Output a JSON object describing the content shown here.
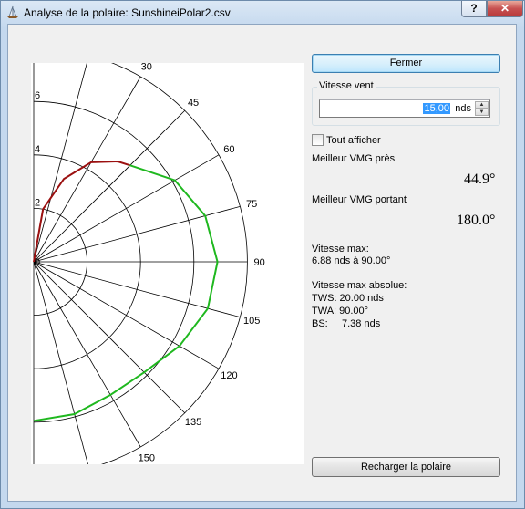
{
  "window": {
    "title": "Analyse de la polaire: SunshineiPolar2.csv",
    "help_label": "?",
    "close_label": "✕"
  },
  "plot": {
    "radial_labels": [
      "2",
      "4",
      "6"
    ],
    "angle_labels": [
      "30",
      "45",
      "60",
      "75",
      "90",
      "105",
      "120",
      "135",
      "150"
    ],
    "origin_label": "0",
    "series_colors": {
      "upwind": "#9b1010",
      "downwind": "#1fb81f"
    }
  },
  "chart_data": {
    "type": "polar",
    "radial_ticks": [
      2,
      4,
      6
    ],
    "angle_ticks": [
      30,
      45,
      60,
      75,
      90,
      105,
      120,
      135,
      150
    ],
    "series": [
      {
        "name": "",
        "color": "#9b1010",
        "points": [
          [
            0,
            0
          ],
          [
            10,
            2.0
          ],
          [
            20,
            3.3
          ],
          [
            30,
            4.3
          ],
          [
            40,
            4.9
          ],
          [
            44.9,
            5.1
          ]
        ]
      },
      {
        "name": "",
        "color": "#1fb81f",
        "points": [
          [
            44.9,
            5.1
          ],
          [
            60,
            6.1
          ],
          [
            75,
            6.65
          ],
          [
            90,
            6.88
          ],
          [
            105,
            6.75
          ],
          [
            120,
            6.3
          ],
          [
            135,
            5.85
          ],
          [
            150,
            5.75
          ],
          [
            165,
            5.9
          ],
          [
            180,
            5.95
          ]
        ]
      }
    ]
  },
  "controls": {
    "close_button": "Fermer",
    "wind_group_label": "Vitesse vent",
    "wind_value": "15,00",
    "wind_unit": "nds",
    "show_all_label": "Tout afficher",
    "reload_button": "Recharger la polaire"
  },
  "stats": {
    "vmg_upwind_label": "Meilleur VMG près",
    "vmg_upwind_value": "44.9°",
    "vmg_downwind_label": "Meilleur VMG portant",
    "vmg_downwind_value": "180.0°",
    "max_speed_label": "Vitesse max:",
    "max_speed_value": "6.88 nds à 90.00°",
    "abs_max_label": "Vitesse max absolue:",
    "tws": "TWS: 20.00 nds",
    "twa": "TWA: 90.00°",
    "bs": "BS:     7.38 nds"
  }
}
